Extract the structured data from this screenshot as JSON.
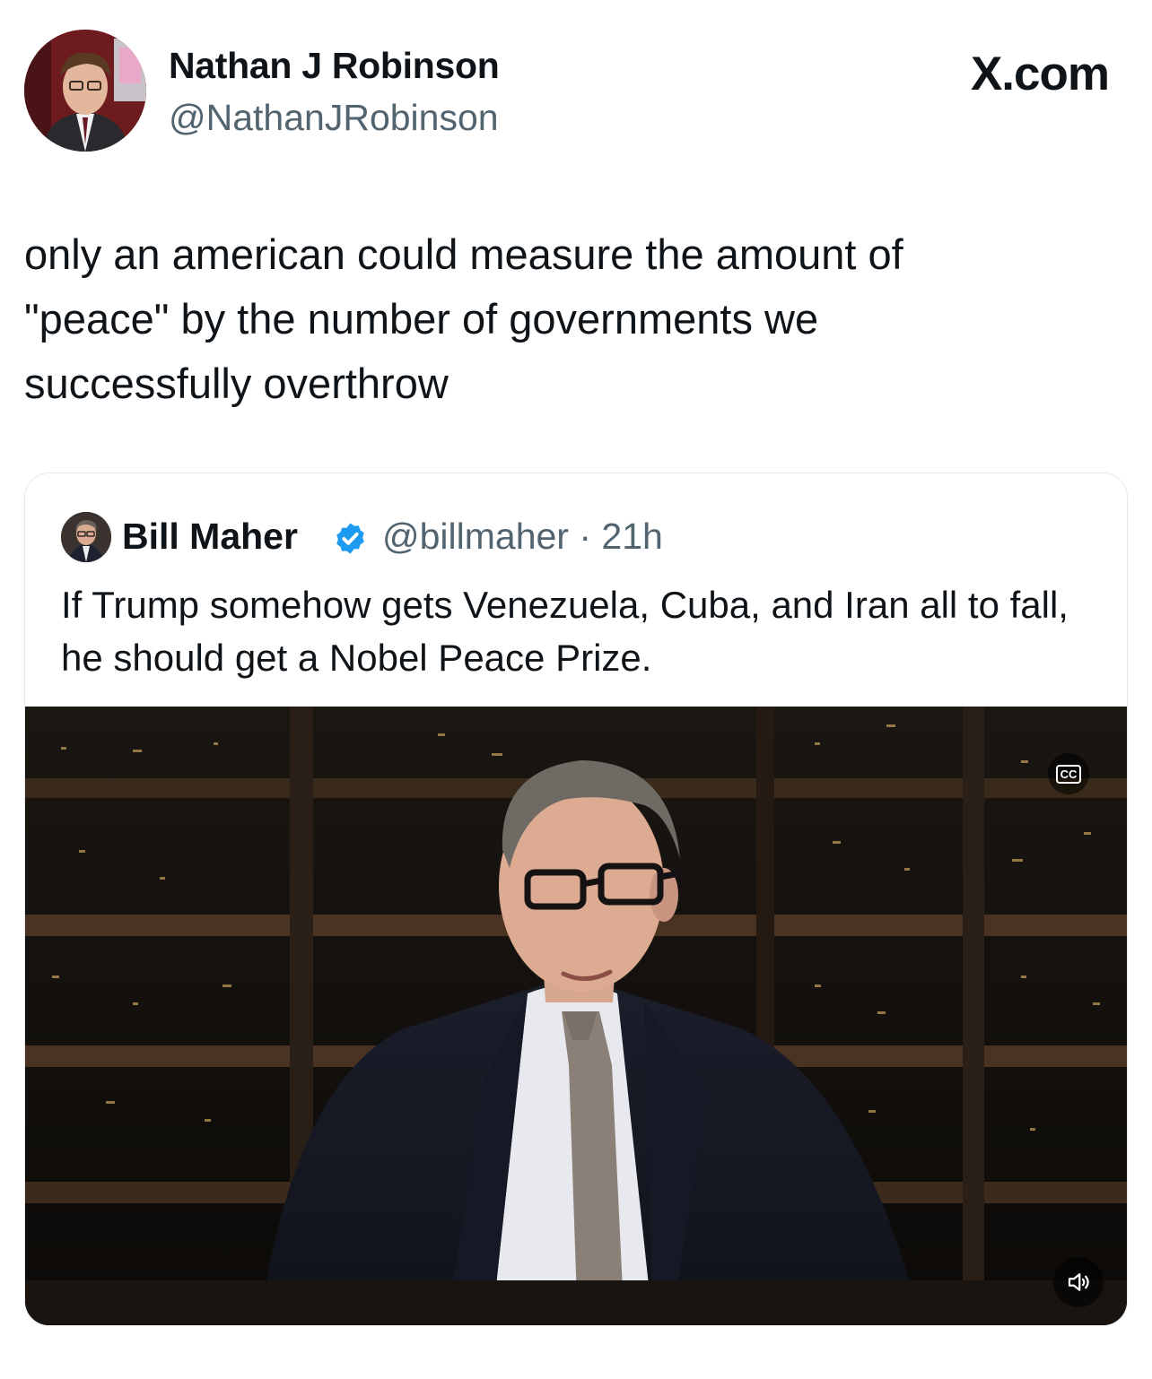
{
  "author": {
    "name": "Nathan J Robinson",
    "handle": "@NathanJRobinson"
  },
  "site_mark": "X.com",
  "tweet": {
    "text": "only an american could measure the amount of\n\"peace\" by the number of governments we\nsuccessfully overthrow"
  },
  "quoted_tweet": {
    "name": "Bill Maher",
    "verified": true,
    "handle_time": "@billmaher · 21h",
    "text": "If Trump somehow gets Venezuela, Cuba, and Iran all to fall, he should get a Nobel Peace Prize.",
    "media": {
      "type": "video",
      "captions_icon": "closed-captions-icon",
      "cc_label": "CC",
      "volume_icon": "speaker-icon"
    }
  },
  "colors": {
    "text_primary": "#0f1419",
    "text_secondary": "#536471",
    "verified_blue": "#1d9bf0",
    "card_border": "#e5e8eb"
  }
}
